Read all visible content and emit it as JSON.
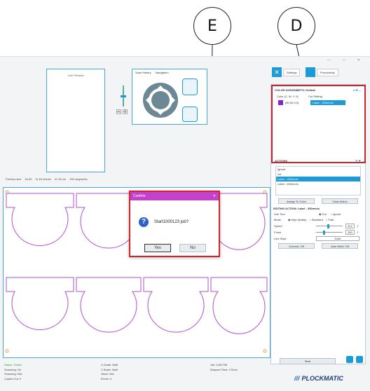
{
  "callouts": {
    "e": "E",
    "d": "D"
  },
  "app": {
    "live_preview": "Live Preview",
    "tabs": [
      "Scan History",
      "Navigation"
    ],
    "preview_size": "Preview size",
    "width": "16.00",
    "height": "11.81 inches",
    "metric": "41  30 cm",
    "segments": "152 segments"
  },
  "toolbar": {
    "settings": "Settings",
    "productivity": "Productivity"
  },
  "color_assign": {
    "title_left": "COLOR ASSIGNME",
    "title_right": "TS: Default",
    "col1": "Color (C, M, Y, K)",
    "col2": "Cut Setting",
    "value": "(60,90,0,0)",
    "setting": "Label - 300mm/s"
  },
  "actions": {
    "title": "ACTIONS",
    "items": [
      "Ignore",
      "cut",
      "Label - 300mm/s",
      "Label - 600mm/s"
    ],
    "assign": "Assign To Color",
    "clear": "Clear Action"
  },
  "editing": {
    "title": "EDITING ACTION: Label - 300mm/s",
    "use_tool": "Use Tool",
    "cut": "Cut",
    "ignore": "Ignore",
    "mode": "Mode",
    "hq": "High Quality",
    "standard": "Standard",
    "fast": "Fast",
    "speed": "Speed",
    "speed_val": "312",
    "force": "Force",
    "force_val": "150",
    "line_style": "Line Style",
    "line_val": "Solid",
    "overcut": "Overcut: Off",
    "autoweld": "Auto Weld: Off"
  },
  "dialog": {
    "title": "Confirm",
    "message": "Start1000123 job?",
    "yes": "Yes",
    "no": "No"
  },
  "status": {
    "col1": [
      "Status: Online",
      "Scanning: On",
      "Scanning: N/A",
      "Copies Cut: 0"
    ],
    "col2": [
      "X-Scale: Wait",
      "Y-Scale: Wait",
      "Skew: N/A",
      "Errors: 0"
    ],
    "col3": [
      "Job: 1451796",
      "Elapsed Time: 0 Secs"
    ]
  },
  "start": "Start",
  "brand": "PLOCKMATIC",
  "colors": {
    "accent": "#1e9bd7",
    "highlight": "#d2232a",
    "shape": "#b04fd0",
    "swatch": "#8a1fd1"
  }
}
